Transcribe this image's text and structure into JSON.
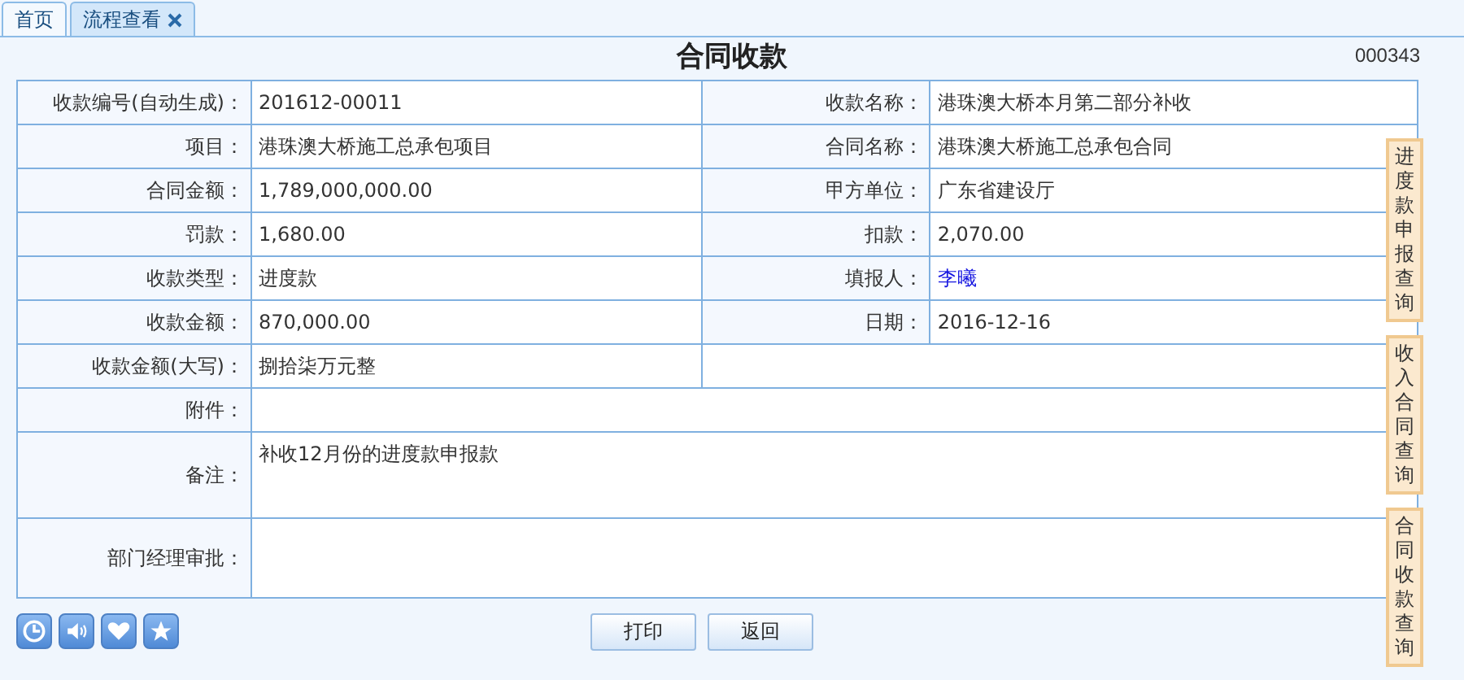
{
  "tabs": [
    {
      "label": "首页",
      "selected": false,
      "closable": false
    },
    {
      "label": "流程查看",
      "selected": true,
      "closable": true
    }
  ],
  "title": "合同收款",
  "doc_number": "000343",
  "rows": [
    {
      "kind": "pair",
      "cells": [
        {
          "label": "收款编号(自动生成)：",
          "value": "201612-00011",
          "kind": "text"
        },
        {
          "label": "收款名称：",
          "value": "港珠澳大桥本月第二部分补收",
          "kind": "text"
        }
      ]
    },
    {
      "kind": "pair",
      "cells": [
        {
          "label": "项目：",
          "value": "港珠澳大桥施工总承包项目",
          "kind": "text"
        },
        {
          "label": "合同名称：",
          "value": "港珠澳大桥施工总承包合同",
          "kind": "text"
        }
      ]
    },
    {
      "kind": "pair",
      "cells": [
        {
          "label": "合同金额：",
          "value": "1,789,000,000.00",
          "kind": "text"
        },
        {
          "label": "甲方单位：",
          "value": "广东省建设厅",
          "kind": "text"
        }
      ]
    },
    {
      "kind": "pair",
      "cells": [
        {
          "label": "罚款：",
          "value": "1,680.00",
          "kind": "text"
        },
        {
          "label": "扣款：",
          "value": "2,070.00",
          "kind": "text"
        }
      ]
    },
    {
      "kind": "pair",
      "cells": [
        {
          "label": "收款类型：",
          "value": "进度款",
          "kind": "text"
        },
        {
          "label": "填报人：",
          "value": "李曦",
          "kind": "link"
        }
      ]
    },
    {
      "kind": "pair",
      "cells": [
        {
          "label": "收款金额：",
          "value": "870,000.00",
          "kind": "text"
        },
        {
          "label": "日期：",
          "value": "2016-12-16",
          "kind": "text"
        }
      ]
    },
    {
      "kind": "half",
      "cells": [
        {
          "label": "收款金额(大写)：",
          "value": "捌拾柒万元整",
          "kind": "text"
        }
      ]
    },
    {
      "kind": "full",
      "cells": [
        {
          "label": "附件："
        }
      ]
    },
    {
      "kind": "memo",
      "cells": [
        {
          "label": "备注：",
          "value": "补收12月份的进度款申报款",
          "kind": "text"
        }
      ]
    },
    {
      "kind": "approval",
      "cells": [
        {
          "label": "部门经理审批："
        }
      ]
    }
  ],
  "side_tabs": [
    "进度款申报查询",
    "收入合同查询",
    "合同收款查询"
  ],
  "tool_icons": [
    {
      "kind": "clock"
    },
    {
      "kind": "speaker"
    },
    {
      "kind": "heart"
    },
    {
      "kind": "star"
    }
  ],
  "buttons": [
    "打印",
    "返回"
  ]
}
